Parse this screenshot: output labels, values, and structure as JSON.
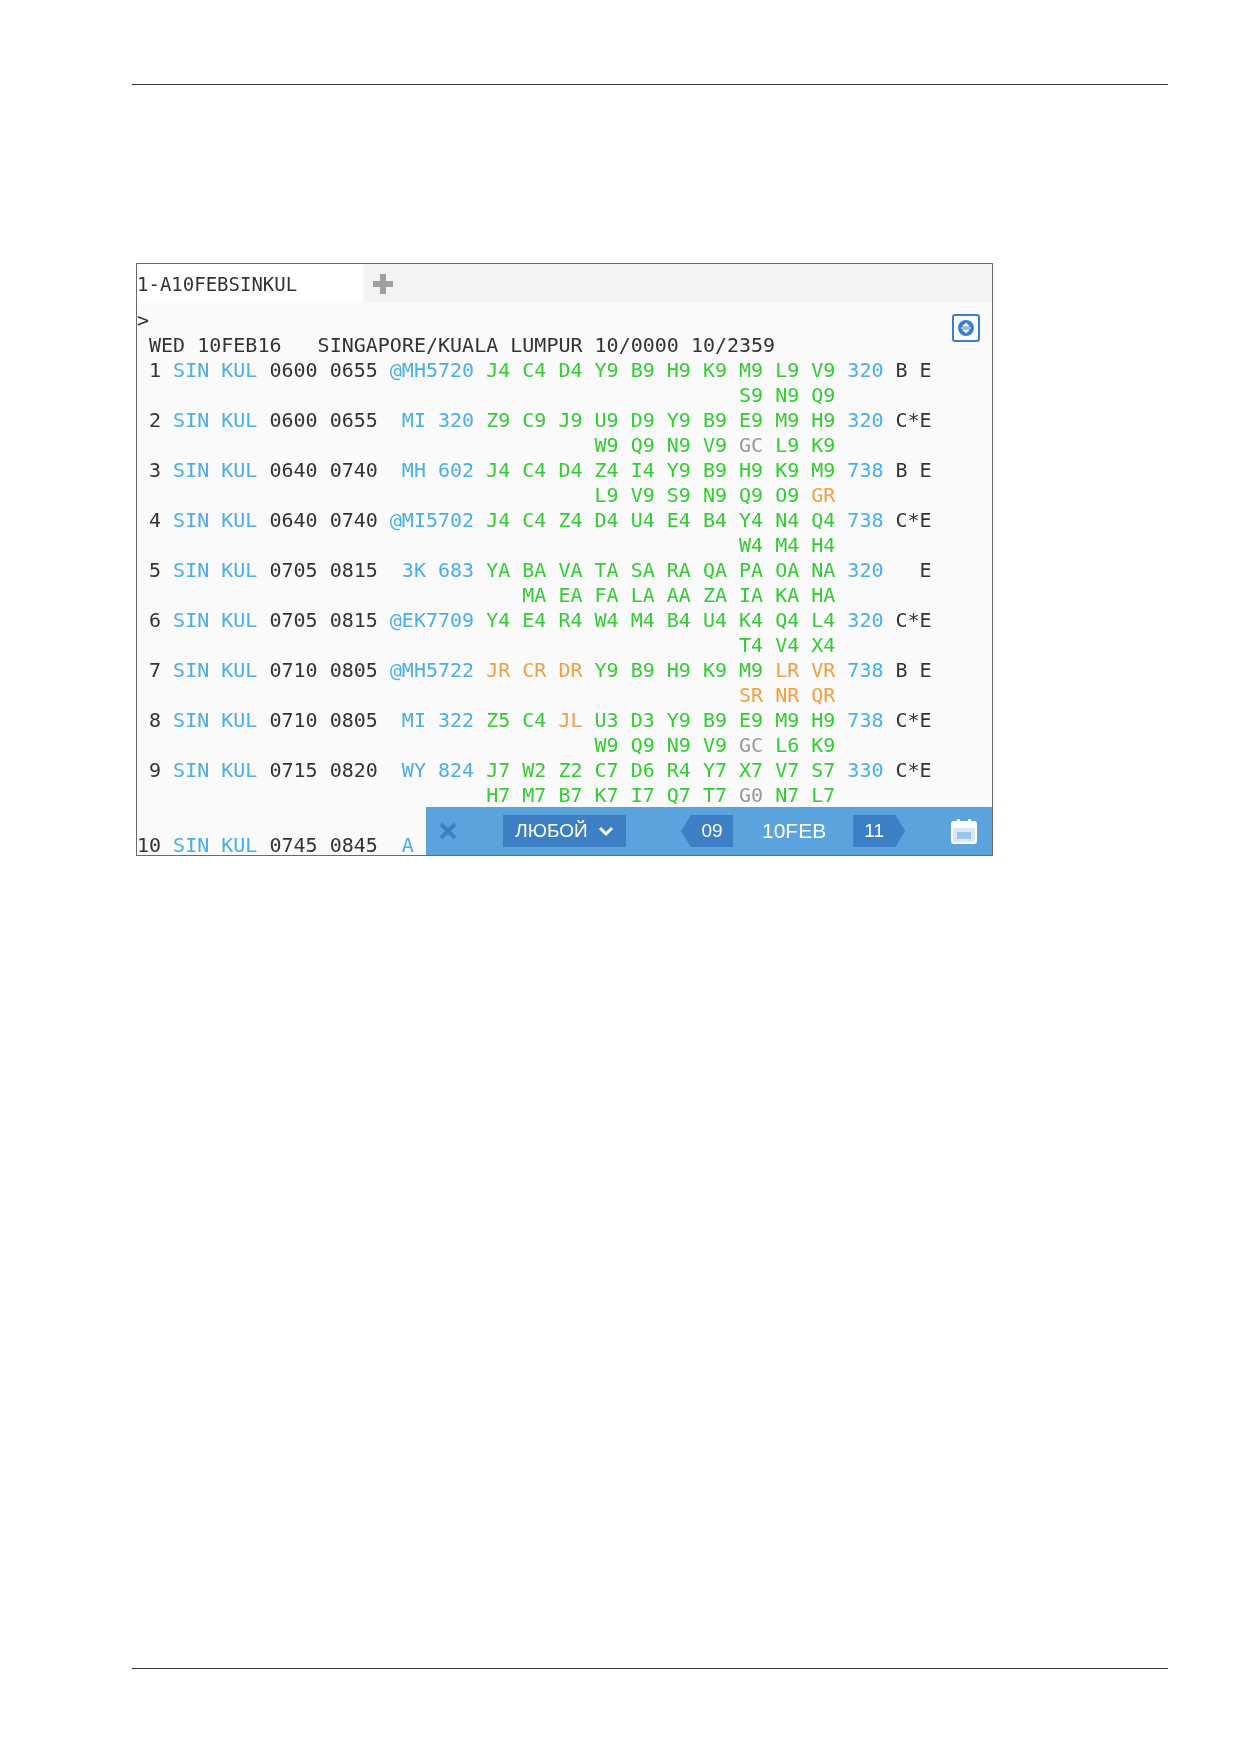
{
  "tab": {
    "label": "1-A10FEBSINKUL"
  },
  "prompt": ">",
  "header": "WED 10FEB16   SINGAPORE/KUALA LUMPUR 10/0000 10/2359",
  "flights": [
    {
      "number": "1",
      "origin": "SIN",
      "destination": "KUL",
      "departure": "0600",
      "arrival": "0655",
      "flight": "@MH5720",
      "classes": [
        {
          "code": "J4",
          "color": "#33cc33"
        },
        {
          "code": "C4",
          "color": "#33cc33"
        },
        {
          "code": "D4",
          "color": "#33cc33"
        },
        {
          "code": "Y9",
          "color": "#33cc33"
        },
        {
          "code": "B9",
          "color": "#33cc33"
        },
        {
          "code": "H9",
          "color": "#33cc33"
        },
        {
          "code": "K9",
          "color": "#33cc33"
        },
        {
          "code": "M9",
          "color": "#33cc33"
        },
        {
          "code": "L9",
          "color": "#33cc33"
        },
        {
          "code": "V9",
          "color": "#33cc33"
        }
      ],
      "more_classes": [
        {
          "code": "S9",
          "color": "#33cc33"
        },
        {
          "code": "N9",
          "color": "#33cc33"
        },
        {
          "code": "Q9",
          "color": "#33cc33"
        }
      ],
      "aircraft": "320",
      "meal": "B E"
    },
    {
      "number": "2",
      "origin": "SIN",
      "destination": "KUL",
      "departure": "0600",
      "arrival": "0655",
      "flight": "MI 320",
      "classes": [
        {
          "code": "Z9",
          "color": "#33cc33"
        },
        {
          "code": "C9",
          "color": "#33cc33"
        },
        {
          "code": "J9",
          "color": "#33cc33"
        },
        {
          "code": "U9",
          "color": "#33cc33"
        },
        {
          "code": "D9",
          "color": "#33cc33"
        },
        {
          "code": "Y9",
          "color": "#33cc33"
        },
        {
          "code": "B9",
          "color": "#33cc33"
        },
        {
          "code": "E9",
          "color": "#33cc33"
        },
        {
          "code": "M9",
          "color": "#33cc33"
        },
        {
          "code": "H9",
          "color": "#33cc33"
        }
      ],
      "more_classes": [
        {
          "code": "W9",
          "color": "#33cc33"
        },
        {
          "code": "Q9",
          "color": "#33cc33"
        },
        {
          "code": "N9",
          "color": "#33cc33"
        },
        {
          "code": "V9",
          "color": "#33cc33"
        },
        {
          "code": "GC",
          "color": "#999999"
        },
        {
          "code": "L9",
          "color": "#33cc33"
        },
        {
          "code": "K9",
          "color": "#33cc33"
        }
      ],
      "aircraft": "320",
      "meal": "C*E"
    },
    {
      "number": "3",
      "origin": "SIN",
      "destination": "KUL",
      "departure": "0640",
      "arrival": "0740",
      "flight": "MH 602",
      "classes": [
        {
          "code": "J4",
          "color": "#33cc33"
        },
        {
          "code": "C4",
          "color": "#33cc33"
        },
        {
          "code": "D4",
          "color": "#33cc33"
        },
        {
          "code": "Z4",
          "color": "#33cc33"
        },
        {
          "code": "I4",
          "color": "#33cc33"
        },
        {
          "code": "Y9",
          "color": "#33cc33"
        },
        {
          "code": "B9",
          "color": "#33cc33"
        },
        {
          "code": "H9",
          "color": "#33cc33"
        },
        {
          "code": "K9",
          "color": "#33cc33"
        },
        {
          "code": "M9",
          "color": "#33cc33"
        }
      ],
      "more_classes": [
        {
          "code": "L9",
          "color": "#33cc33"
        },
        {
          "code": "V9",
          "color": "#33cc33"
        },
        {
          "code": "S9",
          "color": "#33cc33"
        },
        {
          "code": "N9",
          "color": "#33cc33"
        },
        {
          "code": "Q9",
          "color": "#33cc33"
        },
        {
          "code": "O9",
          "color": "#33cc33"
        },
        {
          "code": "GR",
          "color": "#f0a040"
        }
      ],
      "aircraft": "738",
      "meal": "B E"
    },
    {
      "number": "4",
      "origin": "SIN",
      "destination": "KUL",
      "departure": "0640",
      "arrival": "0740",
      "flight": "@MI5702",
      "classes": [
        {
          "code": "J4",
          "color": "#33cc33"
        },
        {
          "code": "C4",
          "color": "#33cc33"
        },
        {
          "code": "Z4",
          "color": "#33cc33"
        },
        {
          "code": "D4",
          "color": "#33cc33"
        },
        {
          "code": "U4",
          "color": "#33cc33"
        },
        {
          "code": "E4",
          "color": "#33cc33"
        },
        {
          "code": "B4",
          "color": "#33cc33"
        },
        {
          "code": "Y4",
          "color": "#33cc33"
        },
        {
          "code": "N4",
          "color": "#33cc33"
        },
        {
          "code": "Q4",
          "color": "#33cc33"
        }
      ],
      "more_classes": [
        {
          "code": "W4",
          "color": "#33cc33"
        },
        {
          "code": "M4",
          "color": "#33cc33"
        },
        {
          "code": "H4",
          "color": "#33cc33"
        }
      ],
      "aircraft": "738",
      "meal": "C*E"
    },
    {
      "number": "5",
      "origin": "SIN",
      "destination": "KUL",
      "departure": "0705",
      "arrival": "0815",
      "flight": "3K 683",
      "classes": [
        {
          "code": "YA",
          "color": "#33cc33"
        },
        {
          "code": "BA",
          "color": "#33cc33"
        },
        {
          "code": "VA",
          "color": "#33cc33"
        },
        {
          "code": "TA",
          "color": "#33cc33"
        },
        {
          "code": "SA",
          "color": "#33cc33"
        },
        {
          "code": "RA",
          "color": "#33cc33"
        },
        {
          "code": "QA",
          "color": "#33cc33"
        },
        {
          "code": "PA",
          "color": "#33cc33"
        },
        {
          "code": "OA",
          "color": "#33cc33"
        },
        {
          "code": "NA",
          "color": "#33cc33"
        }
      ],
      "more_classes": [
        {
          "code": "MA",
          "color": "#33cc33"
        },
        {
          "code": "EA",
          "color": "#33cc33"
        },
        {
          "code": "FA",
          "color": "#33cc33"
        },
        {
          "code": "LA",
          "color": "#33cc33"
        },
        {
          "code": "AA",
          "color": "#33cc33"
        },
        {
          "code": "ZA",
          "color": "#33cc33"
        },
        {
          "code": "IA",
          "color": "#33cc33"
        },
        {
          "code": "KA",
          "color": "#33cc33"
        },
        {
          "code": "HA",
          "color": "#33cc33"
        }
      ],
      "aircraft": "320",
      "meal": "E"
    },
    {
      "number": "6",
      "origin": "SIN",
      "destination": "KUL",
      "departure": "0705",
      "arrival": "0815",
      "flight": "@EK7709",
      "classes": [
        {
          "code": "Y4",
          "color": "#33cc33"
        },
        {
          "code": "E4",
          "color": "#33cc33"
        },
        {
          "code": "R4",
          "color": "#33cc33"
        },
        {
          "code": "W4",
          "color": "#33cc33"
        },
        {
          "code": "M4",
          "color": "#33cc33"
        },
        {
          "code": "B4",
          "color": "#33cc33"
        },
        {
          "code": "U4",
          "color": "#33cc33"
        },
        {
          "code": "K4",
          "color": "#33cc33"
        },
        {
          "code": "Q4",
          "color": "#33cc33"
        },
        {
          "code": "L4",
          "color": "#33cc33"
        }
      ],
      "more_classes": [
        {
          "code": "T4",
          "color": "#33cc33"
        },
        {
          "code": "V4",
          "color": "#33cc33"
        },
        {
          "code": "X4",
          "color": "#33cc33"
        }
      ],
      "aircraft": "320",
      "meal": "C*E"
    },
    {
      "number": "7",
      "origin": "SIN",
      "destination": "KUL",
      "departure": "0710",
      "arrival": "0805",
      "flight": "@MH5722",
      "classes": [
        {
          "code": "JR",
          "color": "#f0a040"
        },
        {
          "code": "CR",
          "color": "#f0a040"
        },
        {
          "code": "DR",
          "color": "#f0a040"
        },
        {
          "code": "Y9",
          "color": "#33cc33"
        },
        {
          "code": "B9",
          "color": "#33cc33"
        },
        {
          "code": "H9",
          "color": "#33cc33"
        },
        {
          "code": "K9",
          "color": "#33cc33"
        },
        {
          "code": "M9",
          "color": "#33cc33"
        },
        {
          "code": "LR",
          "color": "#f0a040"
        },
        {
          "code": "VR",
          "color": "#f0a040"
        }
      ],
      "more_classes": [
        {
          "code": "SR",
          "color": "#f0a040"
        },
        {
          "code": "NR",
          "color": "#f0a040"
        },
        {
          "code": "QR",
          "color": "#f0a040"
        }
      ],
      "aircraft": "738",
      "meal": "B E"
    },
    {
      "number": "8",
      "origin": "SIN",
      "destination": "KUL",
      "departure": "0710",
      "arrival": "0805",
      "flight": "MI 322",
      "classes": [
        {
          "code": "Z5",
          "color": "#33cc33"
        },
        {
          "code": "C4",
          "color": "#33cc33"
        },
        {
          "code": "JL",
          "color": "#f0a040"
        },
        {
          "code": "U3",
          "color": "#33cc33"
        },
        {
          "code": "D3",
          "color": "#33cc33"
        },
        {
          "code": "Y9",
          "color": "#33cc33"
        },
        {
          "code": "B9",
          "color": "#33cc33"
        },
        {
          "code": "E9",
          "color": "#33cc33"
        },
        {
          "code": "M9",
          "color": "#33cc33"
        },
        {
          "code": "H9",
          "color": "#33cc33"
        }
      ],
      "more_classes": [
        {
          "code": "W9",
          "color": "#33cc33"
        },
        {
          "code": "Q9",
          "color": "#33cc33"
        },
        {
          "code": "N9",
          "color": "#33cc33"
        },
        {
          "code": "V9",
          "color": "#33cc33"
        },
        {
          "code": "GC",
          "color": "#999999"
        },
        {
          "code": "L6",
          "color": "#33cc33"
        },
        {
          "code": "K9",
          "color": "#33cc33"
        }
      ],
      "aircraft": "738",
      "meal": "C*E"
    },
    {
      "number": "9",
      "origin": "SIN",
      "destination": "KUL",
      "departure": "0715",
      "arrival": "0820",
      "flight": "WY 824",
      "classes": [
        {
          "code": "J7",
          "color": "#33cc33"
        },
        {
          "code": "W2",
          "color": "#33cc33"
        },
        {
          "code": "Z2",
          "color": "#33cc33"
        },
        {
          "code": "C7",
          "color": "#33cc33"
        },
        {
          "code": "D6",
          "color": "#33cc33"
        },
        {
          "code": "R4",
          "color": "#33cc33"
        },
        {
          "code": "Y7",
          "color": "#33cc33"
        },
        {
          "code": "X7",
          "color": "#33cc33"
        },
        {
          "code": "V7",
          "color": "#33cc33"
        },
        {
          "code": "S7",
          "color": "#33cc33"
        }
      ],
      "more_classes": [
        {
          "code": "H7",
          "color": "#33cc33"
        },
        {
          "code": "M7",
          "color": "#33cc33"
        },
        {
          "code": "B7",
          "color": "#33cc33"
        },
        {
          "code": "K7",
          "color": "#33cc33"
        },
        {
          "code": "I7",
          "color": "#33cc33"
        },
        {
          "code": "Q7",
          "color": "#33cc33"
        },
        {
          "code": "T7",
          "color": "#33cc33"
        },
        {
          "code": "G0",
          "color": "#999999"
        },
        {
          "code": "N7",
          "color": "#33cc33"
        },
        {
          "code": "L7",
          "color": "#33cc33"
        }
      ],
      "aircraft": "330",
      "meal": "C*E"
    },
    {
      "number": "10",
      "origin": "SIN",
      "destination": "KUL",
      "departure": "0745",
      "arrival": "0845",
      "flight": "A"
    }
  ],
  "bar": {
    "filter": "ЛЮБОЙ",
    "prev_day": "09",
    "date": "10FEB",
    "next_day": "11"
  }
}
